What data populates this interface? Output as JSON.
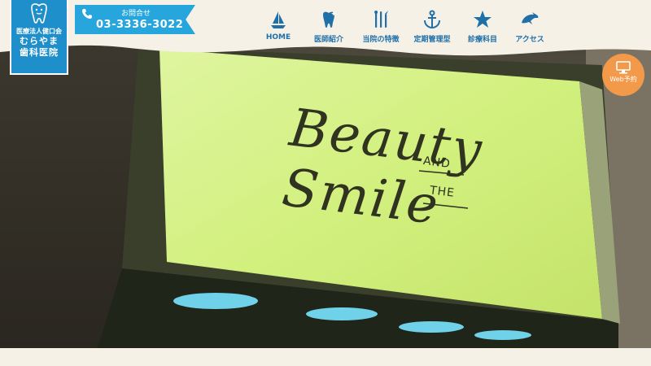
{
  "logo": {
    "corporation": "医療法人健口会",
    "name_line1": "むらやま",
    "name_line2": "歯科医院",
    "icon": "tooth-mascot-icon"
  },
  "contact": {
    "label": "お問合せ",
    "phone": "03-3336-3022",
    "icon": "phone-icon"
  },
  "nav": {
    "items": [
      {
        "label": "HOME",
        "icon": "sailboat-icon"
      },
      {
        "label": "医師紹介",
        "icon": "tooth-icon"
      },
      {
        "label": "当院の特徴",
        "icon": "dental-tools-icon"
      },
      {
        "label": "定期管理型",
        "icon": "anchor-icon"
      },
      {
        "label": "診療科目",
        "icon": "star-icon"
      },
      {
        "label": "アクセス",
        "icon": "dolphin-icon"
      }
    ]
  },
  "web_reservation": {
    "label": "Web予約",
    "icon": "monitor-icon"
  },
  "hero": {
    "sign_main": "Beauty   Smile",
    "sign_and": "AND",
    "sign_the": "THE"
  },
  "colors": {
    "brand_blue": "#1f8fcb",
    "nav_text": "#1f6fa8",
    "accent_orange": "#f2994a",
    "background": "#f6f1e7"
  }
}
